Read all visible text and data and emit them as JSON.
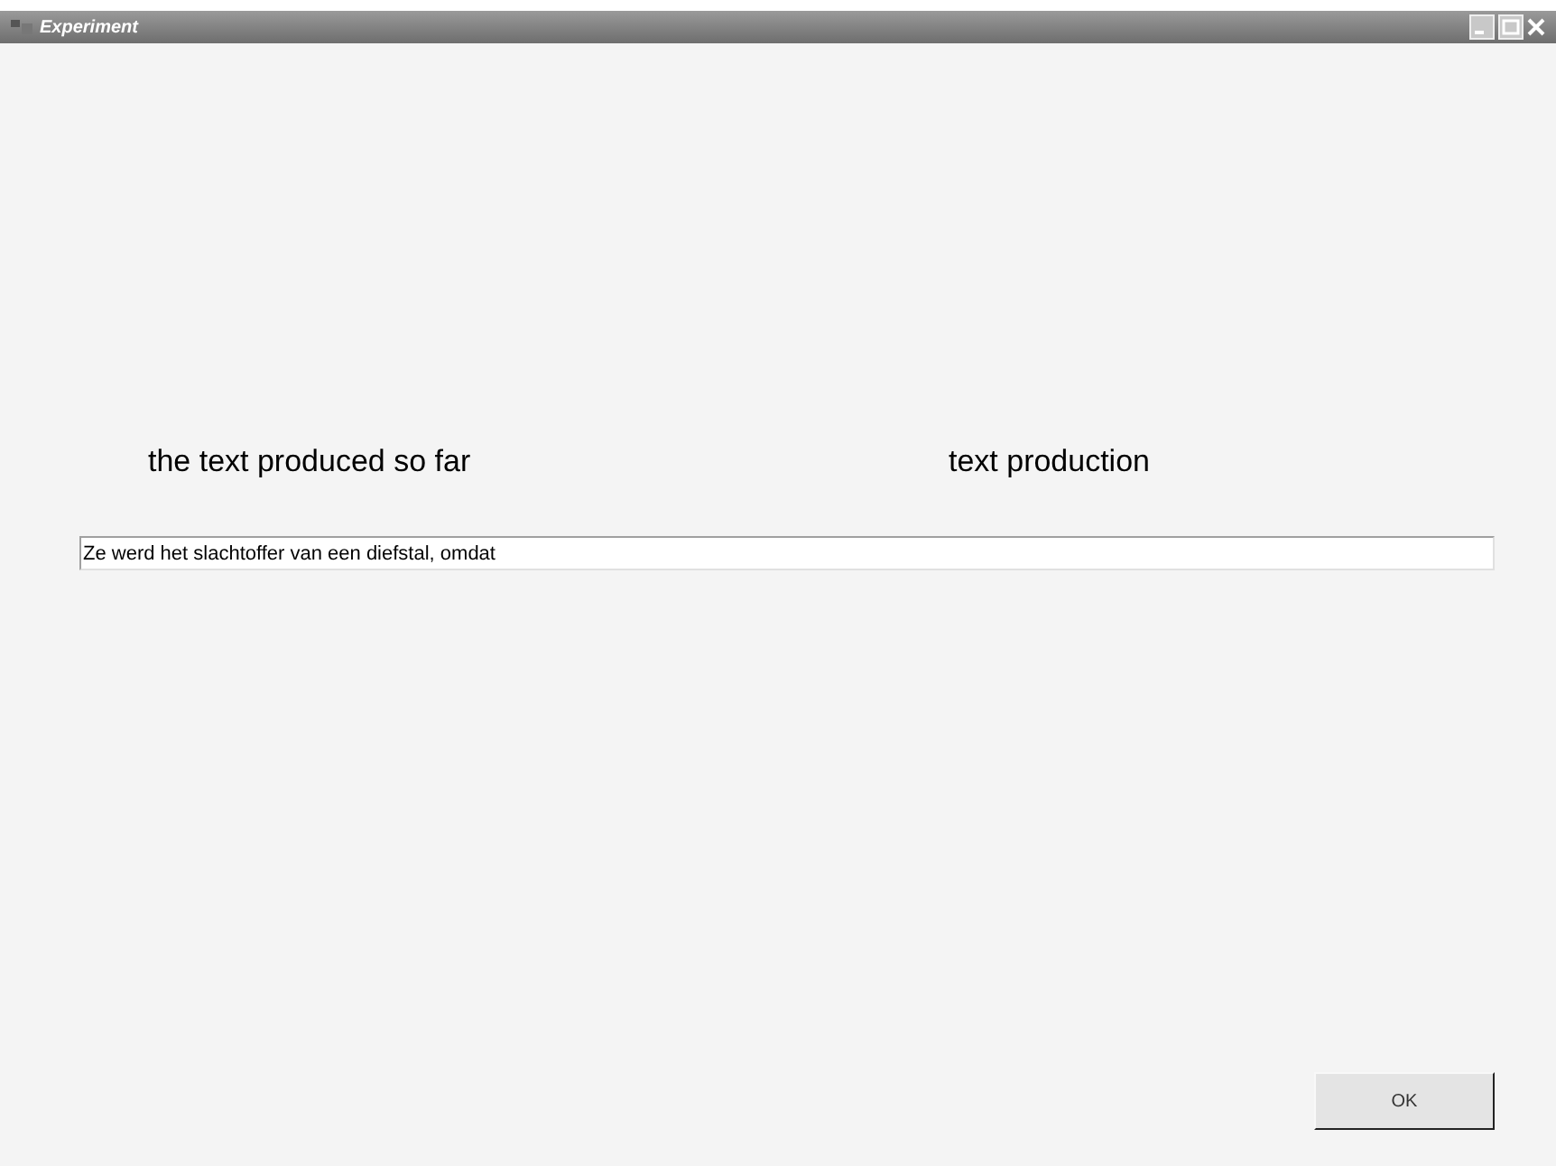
{
  "window": {
    "title": "Experiment"
  },
  "labels": [
    "the text produced so far",
    "text production"
  ],
  "text_field": {
    "value": "Ze werd het slachtoffer van een diefstal, omdat"
  },
  "buttons": [
    "OK"
  ]
}
